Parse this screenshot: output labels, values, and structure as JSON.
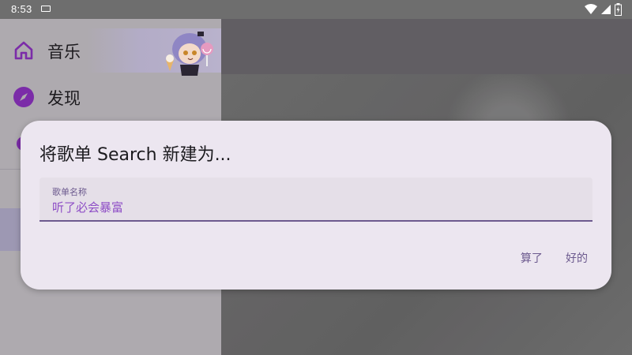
{
  "status_bar": {
    "time": "8:53",
    "icons": [
      "keyboard-icon",
      "wifi-icon",
      "signal-icon",
      "battery-icon"
    ]
  },
  "drawer": {
    "items": [
      {
        "label": "音乐",
        "icon": "home-icon"
      },
      {
        "label": "发现",
        "icon": "compass-icon"
      },
      {
        "label": "",
        "icon": "gear-icon"
      }
    ]
  },
  "dialog": {
    "title": "将歌单 Search 新建为...",
    "field_label": "歌单名称",
    "field_value": "听了必会暴富",
    "cancel_label": "算了",
    "ok_label": "好的"
  },
  "colors": {
    "accent": "#6c5a8e",
    "input_text": "#8e4ec6",
    "icon_purple": "#7b2ca8",
    "dialog_bg": "#ece6f0"
  }
}
